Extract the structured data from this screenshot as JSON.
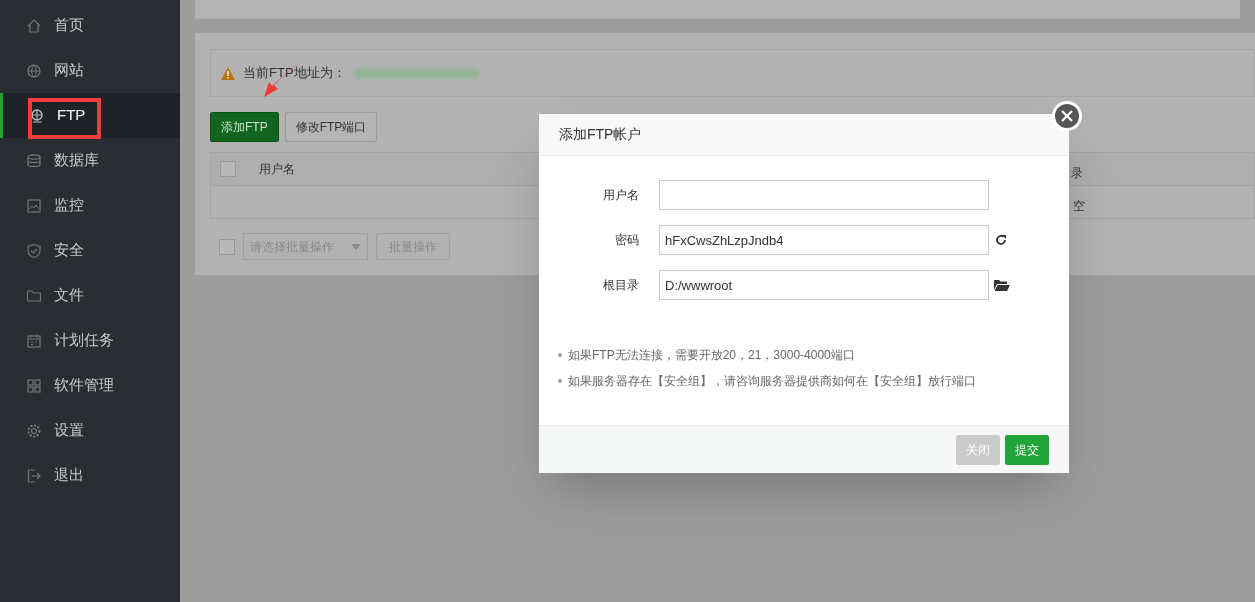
{
  "sidebar": {
    "items": [
      {
        "label": "首页",
        "selected": false
      },
      {
        "label": "网站",
        "selected": false
      },
      {
        "label": "FTP",
        "selected": true
      },
      {
        "label": "数据库",
        "selected": false
      },
      {
        "label": "监控",
        "selected": false
      },
      {
        "label": "安全",
        "selected": false
      },
      {
        "label": "文件",
        "selected": false
      },
      {
        "label": "计划任务",
        "selected": false
      },
      {
        "label": "软件管理",
        "selected": false
      },
      {
        "label": "设置",
        "selected": false
      },
      {
        "label": "退出",
        "selected": false
      }
    ]
  },
  "notice": {
    "label": "当前FTP地址为："
  },
  "toolbar": {
    "buttons": [
      {
        "label": "添加FTP",
        "kind": "primary"
      },
      {
        "label": "修改FTP端口",
        "kind": "default"
      }
    ]
  },
  "table": {
    "select_all": {
      "checked": false
    },
    "columns": [
      "用户名",
      "录"
    ],
    "rows": [
      {
        "column_2": "空"
      }
    ]
  },
  "batch": {
    "checkbox": {
      "checked": false
    },
    "placeholder": "请选择批量操作",
    "button": "批量操作"
  },
  "dialog": {
    "title": "添加FTP帐户",
    "fields": [
      {
        "label": "用户名",
        "kind": "plain"
      },
      {
        "label": "密码",
        "value": "hFxCwsZhLzpJndb4",
        "kind": "refresh"
      },
      {
        "label": "根目录",
        "value": "D:/wwwroot",
        "kind": "folder"
      }
    ],
    "notes": [
      "如果FTP无法连接，需要开放20，21，3000-4000端口",
      "如果服务器存在【安全组】，请咨询服务器提供商如何在【安全组】放行端口"
    ],
    "buttons": [
      {
        "label": "关闭",
        "kind": "secondary"
      },
      {
        "label": "提交",
        "kind": "primary"
      }
    ]
  }
}
